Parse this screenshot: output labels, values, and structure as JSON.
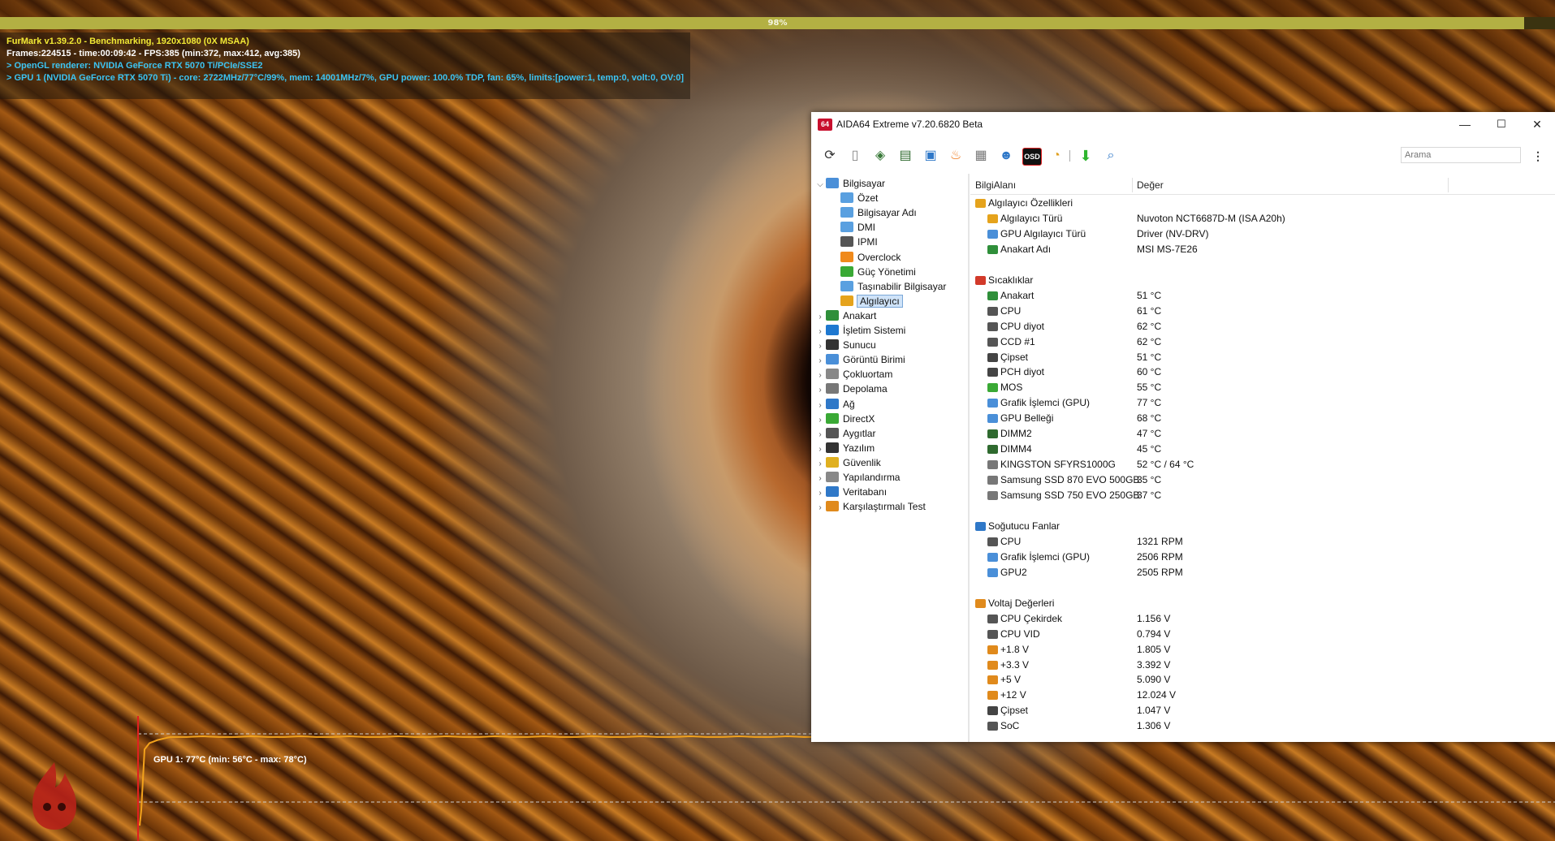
{
  "furmark": {
    "progress_text": "98%",
    "progress_value": 0.98,
    "line1": "FurMark v1.39.2.0 - Benchmarking, 1920x1080 (0X MSAA)",
    "line2": "Frames:224515 - time:00:09:42 - FPS:385 (min:372, max:412, avg:385)",
    "line3": "> OpenGL renderer: NVIDIA GeForce RTX 5070 Ti/PCIe/SSE2",
    "line4": "> GPU 1 (NVIDIA GeForce RTX 5070 Ti) - core: 2722MHz/77°C/99%, mem: 14001MHz/7%, GPU power: 100.0% TDP, fan: 65%, limits:[power:1, temp:0, volt:0, OV:0]",
    "graph_label": "GPU 1: 77°C (min: 56°C - max: 78°C)",
    "graph_min": 56,
    "graph_max": 78,
    "graph_current": 77
  },
  "window": {
    "logo_text": "64",
    "title": "AIDA64 Extreme v7.20.6820 Beta",
    "minimize": "—",
    "maximize": "☐",
    "close": "✕"
  },
  "toolbar": {
    "search_placeholder": "Arama",
    "more": "⋮",
    "icons": [
      "refresh-icon",
      "report-icon",
      "motherboard-icon",
      "memory-icon",
      "network-icon",
      "flame-icon",
      "cpuid-icon",
      "user-icon",
      "osd-icon",
      "gauge-icon",
      "download-icon",
      "search-icon"
    ],
    "osd_label": "OSD"
  },
  "tree": {
    "items": [
      {
        "label": "Bilgisayar",
        "level": 0,
        "expanded": true,
        "color": "#4a8fd8"
      },
      {
        "label": "Özet",
        "level": 1,
        "color": "#5aa0e0"
      },
      {
        "label": "Bilgisayar Adı",
        "level": 1,
        "color": "#5aa0e0"
      },
      {
        "label": "DMI",
        "level": 1,
        "color": "#5aa0e0"
      },
      {
        "label": "IPMI",
        "level": 1,
        "color": "#555"
      },
      {
        "label": "Overclock",
        "level": 1,
        "color": "#f08a1c"
      },
      {
        "label": "Güç Yönetimi",
        "level": 1,
        "color": "#3aa935"
      },
      {
        "label": "Taşınabilir Bilgisayar",
        "level": 1,
        "color": "#5aa0e0"
      },
      {
        "label": "Algılayıcı",
        "level": 1,
        "selected": true,
        "color": "#e5a31c"
      },
      {
        "label": "Anakart",
        "level": 0,
        "color": "#2f8f3a"
      },
      {
        "label": "İşletim Sistemi",
        "level": 0,
        "color": "#1e78d0"
      },
      {
        "label": "Sunucu",
        "level": 0,
        "color": "#333"
      },
      {
        "label": "Görüntü Birimi",
        "level": 0,
        "color": "#4a8fd8"
      },
      {
        "label": "Çokluortam",
        "level": 0,
        "color": "#888"
      },
      {
        "label": "Depolama",
        "level": 0,
        "color": "#777"
      },
      {
        "label": "Ağ",
        "level": 0,
        "color": "#2f78c8"
      },
      {
        "label": "DirectX",
        "level": 0,
        "color": "#3aa935"
      },
      {
        "label": "Aygıtlar",
        "level": 0,
        "color": "#555"
      },
      {
        "label": "Yazılım",
        "level": 0,
        "color": "#333"
      },
      {
        "label": "Güvenlik",
        "level": 0,
        "color": "#e0b020"
      },
      {
        "label": "Yapılandırma",
        "level": 0,
        "color": "#888"
      },
      {
        "label": "Veritabanı",
        "level": 0,
        "color": "#2f78c8"
      },
      {
        "label": "Karşılaştırmalı Test",
        "level": 0,
        "color": "#e08a1c"
      }
    ]
  },
  "list": {
    "col_name": "BilgiAlanı",
    "col_value": "Değer",
    "rows": [
      {
        "kind": "group",
        "name": "Algılayıcı Özellikleri",
        "color": "#e5a31c"
      },
      {
        "name": "Algılayıcı Türü",
        "value": "Nuvoton NCT6687D-M  (ISA A20h)",
        "color": "#e5a31c"
      },
      {
        "name": "GPU Algılayıcı Türü",
        "value": "Driver  (NV-DRV)",
        "color": "#4a8fd8"
      },
      {
        "name": "Anakart Adı",
        "value": "MSI MS-7E26",
        "color": "#2f8f3a"
      },
      {
        "kind": "blank"
      },
      {
        "kind": "group",
        "name": "Sıcaklıklar",
        "color": "#d23a2a"
      },
      {
        "name": "Anakart",
        "value": "51 °C",
        "color": "#2f8f3a"
      },
      {
        "name": "CPU",
        "value": "61 °C",
        "color": "#555"
      },
      {
        "name": "CPU diyot",
        "value": "62 °C",
        "color": "#555"
      },
      {
        "name": "CCD #1",
        "value": "62 °C",
        "color": "#555"
      },
      {
        "name": "Çipset",
        "value": "51 °C",
        "color": "#444"
      },
      {
        "name": "PCH diyot",
        "value": "60 °C",
        "color": "#444"
      },
      {
        "name": "MOS",
        "value": "55 °C",
        "color": "#3aa935"
      },
      {
        "name": "Grafik İşlemci (GPU)",
        "value": "77 °C",
        "color": "#4a8fd8"
      },
      {
        "name": "GPU Belleği",
        "value": "68 °C",
        "color": "#4a8fd8"
      },
      {
        "name": "DIMM2",
        "value": "47 °C",
        "color": "#2f6a2f"
      },
      {
        "name": "DIMM4",
        "value": "45 °C",
        "color": "#2f6a2f"
      },
      {
        "name": "KINGSTON SFYRS1000G",
        "value": "52 °C / 64 °C",
        "color": "#777"
      },
      {
        "name": "Samsung SSD 870 EVO 500GB",
        "value": "35 °C",
        "color": "#777"
      },
      {
        "name": "Samsung SSD 750 EVO 250GB",
        "value": "37 °C",
        "color": "#777"
      },
      {
        "kind": "blank"
      },
      {
        "kind": "group",
        "name": "Soğutucu Fanlar",
        "color": "#2f78c8"
      },
      {
        "name": "CPU",
        "value": "1321 RPM",
        "color": "#555"
      },
      {
        "name": "Grafik İşlemci (GPU)",
        "value": "2506 RPM",
        "color": "#4a8fd8"
      },
      {
        "name": "GPU2",
        "value": "2505 RPM",
        "color": "#4a8fd8"
      },
      {
        "kind": "blank"
      },
      {
        "kind": "group",
        "name": "Voltaj Değerleri",
        "color": "#e08a1c"
      },
      {
        "name": "CPU Çekirdek",
        "value": "1.156 V",
        "color": "#555"
      },
      {
        "name": "CPU VID",
        "value": "0.794 V",
        "color": "#555"
      },
      {
        "name": "+1.8 V",
        "value": "1.805 V",
        "color": "#e08a1c"
      },
      {
        "name": "+3.3 V",
        "value": "3.392 V",
        "color": "#e08a1c"
      },
      {
        "name": "+5 V",
        "value": "5.090 V",
        "color": "#e08a1c"
      },
      {
        "name": "+12 V",
        "value": "12.024 V",
        "color": "#e08a1c"
      },
      {
        "name": "Çipset",
        "value": "1.047 V",
        "color": "#444"
      },
      {
        "name": "SoC",
        "value": "1.306 V",
        "color": "#555"
      }
    ]
  }
}
